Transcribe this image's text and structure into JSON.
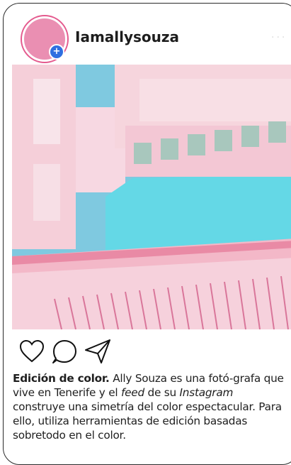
{
  "post": {
    "username": "Iamallysouza",
    "caption": {
      "lead": "Edición de color.",
      "part1": " Ally Souza es una fotó-grafa que vive en Tenerife y el ",
      "feed": "feed",
      "part2": " de su ",
      "instagram": "Instagram",
      "part3": " construye una simetría del color espectacular. Para ello, utiliza herramientas de edición basadas sobretodo en el color."
    }
  },
  "icons": {
    "like": "heart-icon",
    "comment": "comment-icon",
    "share": "send-icon",
    "more": "more-icon",
    "add": "plus-icon"
  },
  "colors": {
    "avatar": "#ea8fb2",
    "avatar_ring": "#e45a8e",
    "badge": "#2f6fe0",
    "sky": "#7fc9e0",
    "building_pink": "#f2c7d3",
    "building_teal": "#64d8e6"
  }
}
